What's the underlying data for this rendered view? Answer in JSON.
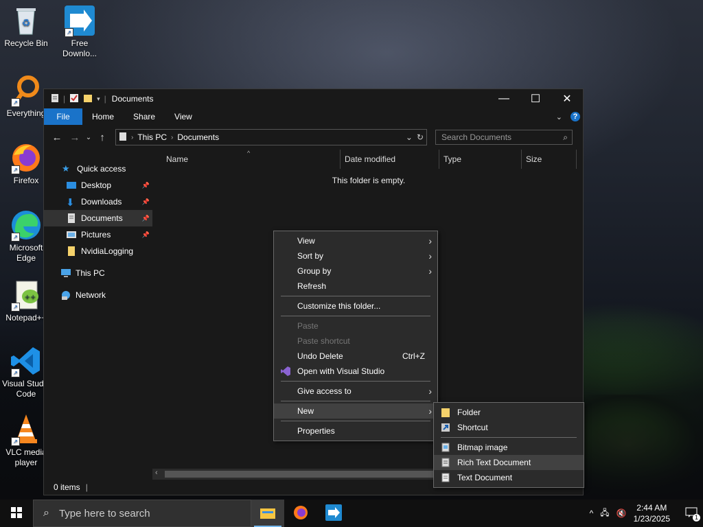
{
  "desktop": {
    "icons": [
      {
        "label": "Recycle Bin",
        "icon": "recycle-bin-icon"
      },
      {
        "label": "Free Downlo...",
        "icon": "free-download-manager-icon"
      },
      {
        "label": "Everything",
        "icon": "everything-search-icon"
      },
      {
        "label": "Firefox",
        "icon": "firefox-icon"
      },
      {
        "label": "Microsoft Edge",
        "icon": "edge-icon"
      },
      {
        "label": "Notepad++",
        "icon": "notepadpp-icon"
      },
      {
        "label": "Visual Studio Code",
        "icon": "vscode-icon"
      },
      {
        "label": "VLC media player",
        "icon": "vlc-icon"
      }
    ]
  },
  "explorer": {
    "title": "Documents",
    "ribbon_tabs": [
      "File",
      "Home",
      "Share",
      "View"
    ],
    "address": {
      "crumbs": [
        "This PC",
        "Documents"
      ]
    },
    "search": {
      "placeholder": "Search Documents"
    },
    "nav": {
      "quick_access": "Quick access",
      "items": [
        "Desktop",
        "Downloads",
        "Documents",
        "Pictures",
        "NvidiaLogging"
      ],
      "this_pc": "This PC",
      "network": "Network"
    },
    "columns": [
      "Name",
      "Date modified",
      "Type",
      "Size"
    ],
    "empty_text": "This folder is empty.",
    "status": "0 items"
  },
  "context_menu": {
    "items": [
      {
        "label": "View",
        "submenu": true
      },
      {
        "label": "Sort by",
        "submenu": true
      },
      {
        "label": "Group by",
        "submenu": true
      },
      {
        "label": "Refresh"
      },
      {
        "label": "Customize this folder..."
      },
      {
        "label": "Paste",
        "disabled": true
      },
      {
        "label": "Paste shortcut",
        "disabled": true
      },
      {
        "label": "Undo Delete",
        "shortcut": "Ctrl+Z"
      },
      {
        "label": "Open with Visual Studio"
      },
      {
        "label": "Give access to",
        "submenu": true
      },
      {
        "label": "New",
        "submenu": true
      },
      {
        "label": "Properties"
      }
    ]
  },
  "new_submenu": {
    "items": [
      "Folder",
      "Shortcut",
      "Bitmap image",
      "Rich Text Document",
      "Text Document"
    ]
  },
  "taskbar": {
    "search_placeholder": "Type here to search",
    "time": "2:44 AM",
    "date": "1/23/2025",
    "notification_count": "1"
  },
  "colors": {
    "accent": "#1a73c9",
    "window_bg": "#191919",
    "menu_bg": "#2b2b2b"
  }
}
